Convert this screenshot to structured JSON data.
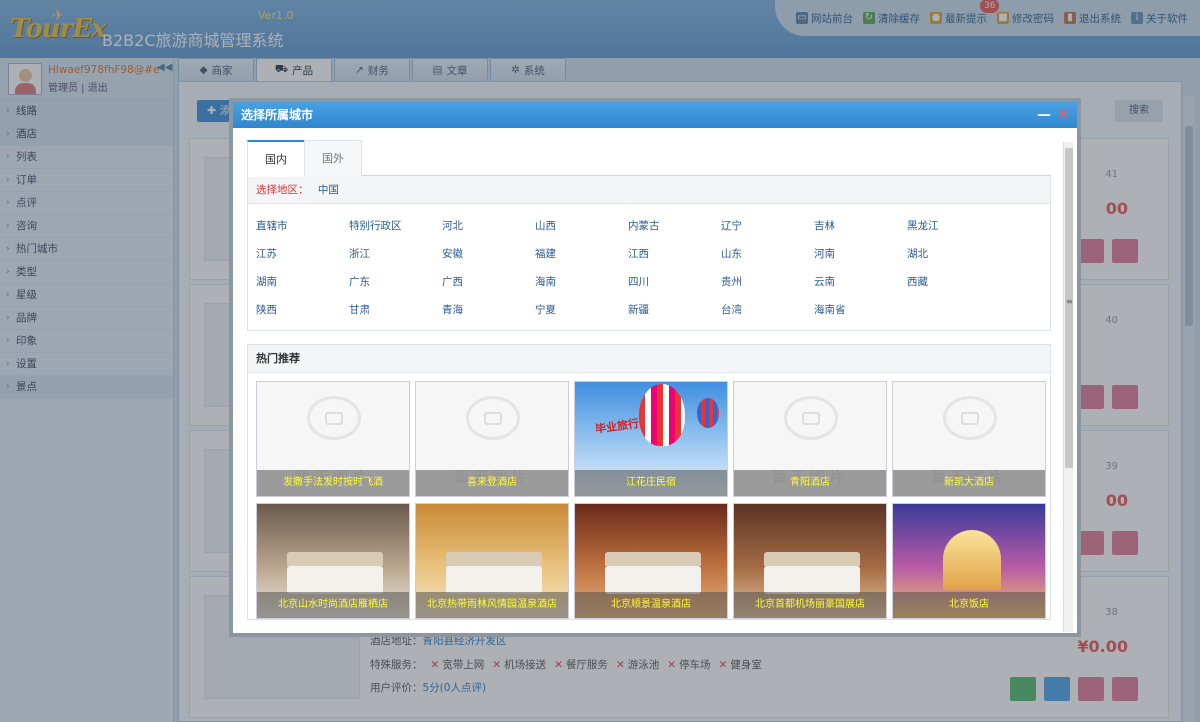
{
  "header": {
    "logo": "TourEx",
    "title": "B2B2C旅游商城管理系统",
    "version": "Ver1.0",
    "links": [
      {
        "label": "网站前台",
        "icon": "monitor-icon",
        "color": "#5a7fa6"
      },
      {
        "label": "清除缓存",
        "icon": "refresh-icon",
        "color": "#5aa64a"
      },
      {
        "label": "最新提示",
        "icon": "bell-icon",
        "color": "#e0a020",
        "badge": "36"
      },
      {
        "label": "修改密码",
        "icon": "lock-icon",
        "color": "#d8a030"
      },
      {
        "label": "退出系统",
        "icon": "exit-icon",
        "color": "#c07050"
      },
      {
        "label": "关于软件",
        "icon": "info-icon",
        "color": "#6a8fb6"
      }
    ]
  },
  "user": {
    "name": "Hlwaef978fhF98@#e",
    "role": "管理员",
    "logout": "退出"
  },
  "sidebar": {
    "items": [
      {
        "label": "线路",
        "group": true
      },
      {
        "label": "酒店",
        "group": true
      },
      {
        "label": "列表",
        "group": false
      },
      {
        "label": "订单",
        "group": false
      },
      {
        "label": "点评",
        "group": false
      },
      {
        "label": "咨询",
        "group": false
      },
      {
        "label": "热门城市",
        "group": false
      },
      {
        "label": "类型",
        "group": false
      },
      {
        "label": "星级",
        "group": false
      },
      {
        "label": "品牌",
        "group": false
      },
      {
        "label": "印象",
        "group": false
      },
      {
        "label": "设置",
        "group": false
      },
      {
        "label": "景点",
        "group": true
      }
    ]
  },
  "tabs": [
    {
      "label": "商家",
      "icon": "tag-icon",
      "active": false
    },
    {
      "label": "产品",
      "icon": "cart-icon",
      "active": true
    },
    {
      "label": "财务",
      "icon": "chart-icon",
      "active": false
    },
    {
      "label": "文章",
      "icon": "newspaper-icon",
      "active": false
    },
    {
      "label": "系统",
      "icon": "gear-icon",
      "active": false
    }
  ],
  "content": {
    "add_label": "添",
    "search_label": "搜索",
    "cards": [
      {
        "num": "41",
        "price": "00"
      },
      {
        "num": "40",
        "price": ""
      },
      {
        "num": "39",
        "price": "00"
      },
      {
        "num": "38",
        "price": "¥0.00"
      }
    ],
    "last_card": {
      "address_label": "酒店地址：",
      "address": "青阳县经济开发区",
      "service_label": "特殊服务：",
      "services": [
        "宽带上网",
        "机场接送",
        "餐厅服务",
        "游泳池",
        "停车场",
        "健身室"
      ],
      "rating_label": "用户评价：",
      "rating": "5分(0人点评)",
      "noimg": "暂无图片"
    }
  },
  "modal": {
    "title": "选择所属城市",
    "tabs": [
      {
        "label": "国内",
        "active": true
      },
      {
        "label": "国外",
        "active": false
      }
    ],
    "region_label": "选择地区：",
    "region_value": "中国",
    "regions": [
      "直辖市",
      "特别行政区",
      "河北",
      "山西",
      "内蒙古",
      "辽宁",
      "吉林",
      "黑龙江",
      "江苏",
      "浙江",
      "安徽",
      "福建",
      "江西",
      "山东",
      "河南",
      "湖北",
      "湖南",
      "广东",
      "广西",
      "海南",
      "四川",
      "贵州",
      "云南",
      "西藏",
      "陕西",
      "甘肃",
      "青海",
      "宁夏",
      "新疆",
      "台湾",
      "海南省"
    ],
    "hot_title": "热门推荐",
    "noimg": "暂无图片",
    "hotels": [
      {
        "name": "发撒手法发时按时飞酒",
        "img": "noimg"
      },
      {
        "name": "喜来登酒店",
        "img": "noimg"
      },
      {
        "name": "江花庄民宿",
        "img": "balloon",
        "banner": "毕业旅行"
      },
      {
        "name": "青阳酒店",
        "img": "noimg"
      },
      {
        "name": "新凯大酒店",
        "img": "noimg"
      },
      {
        "name": "北京山水时尚酒店雁栖店",
        "img": "room1"
      },
      {
        "name": "北京热带雨林风情园温泉酒店",
        "img": "room2"
      },
      {
        "name": "北京顺景温泉酒店",
        "img": "room3"
      },
      {
        "name": "北京首都机场丽豪国展店",
        "img": "room4"
      },
      {
        "name": "北京饭店",
        "img": "night"
      }
    ]
  }
}
